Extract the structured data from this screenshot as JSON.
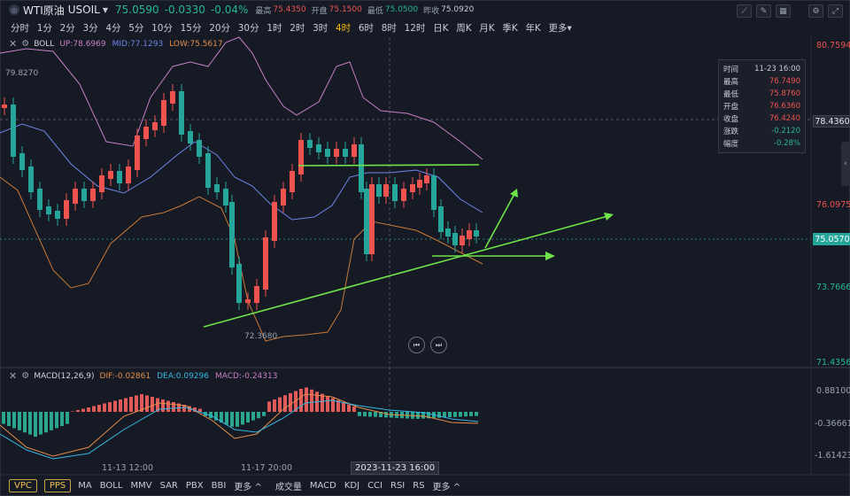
{
  "header": {
    "logo_glyph": "◎",
    "instrument_name": "WTI原油",
    "symbol": "USOIL",
    "price": "75.0590",
    "change": "-0.0330",
    "change_pct": "-0.04%",
    "stats": [
      {
        "label": "最高",
        "value": "75.4350",
        "tone": "red"
      },
      {
        "label": "开盘",
        "value": "75.1500",
        "tone": "red"
      },
      {
        "label": "最低",
        "value": "75.0500",
        "tone": "grn"
      },
      {
        "label": "昨收",
        "value": "75.0920",
        "tone": "gry"
      }
    ],
    "tools": [
      "draw-line-icon",
      "pencil-icon",
      "eraser-icon",
      "settings-icon",
      "fullscreen-icon"
    ]
  },
  "periods": {
    "items": [
      "分时",
      "1分",
      "2分",
      "3分",
      "4分",
      "5分",
      "10分",
      "15分",
      "20分",
      "30分",
      "1时",
      "2时",
      "3时",
      "4时",
      "6时",
      "8时",
      "12时",
      "日K",
      "周K",
      "月K",
      "季K",
      "年K",
      "更多▾"
    ],
    "active": "4时"
  },
  "boll_legend": {
    "name": "BOLL",
    "up": "UP:78.6969",
    "mid": "MID:77.1293",
    "low": "LOW:75.5617"
  },
  "macd_legend": {
    "name": "MACD(12,26,9)",
    "dif": "DIF:-0.02861",
    "dea": "DEA:0.09296",
    "macd": "MACD:-0.24313"
  },
  "price_axis": {
    "labels": [
      {
        "text": "80.7594",
        "tone": "red"
      },
      {
        "text": "76.0975",
        "tone": "red"
      },
      {
        "text": "73.7666",
        "tone": "grn"
      },
      {
        "text": "71.4356",
        "tone": "grn"
      }
    ],
    "crosshair_price": "78.4360",
    "current_price": "75.0570"
  },
  "macd_axis": {
    "labels": [
      "0.88100",
      "-0.36661",
      "-1.61423"
    ]
  },
  "chart_annotations": {
    "high_label": "79.8270",
    "low_label": "72.3680"
  },
  "info_box": {
    "rows": [
      {
        "label": "时间",
        "value": "11-23 16:00",
        "tone": ""
      },
      {
        "label": "最高",
        "value": "76.7490",
        "tone": "red"
      },
      {
        "label": "最低",
        "value": "75.8760",
        "tone": "red"
      },
      {
        "label": "开盘",
        "value": "76.6360",
        "tone": "red"
      },
      {
        "label": "收盘",
        "value": "76.4240",
        "tone": "red"
      },
      {
        "label": "涨跌",
        "value": "-0.2120",
        "tone": "grn"
      },
      {
        "label": "幅度",
        "value": "-0.28%",
        "tone": "grn"
      }
    ]
  },
  "time_axis": {
    "labels": [
      "11-13 12:00",
      "11-17 20:00"
    ],
    "crosshair_time": "2023-11-23 16:00"
  },
  "bottom_bar": {
    "pills": [
      "VPC",
      "PPS"
    ],
    "main_indicators": [
      "MA",
      "BOLL",
      "MMV",
      "SAR",
      "PBX",
      "BBI",
      "更多 ^"
    ],
    "sub_indicators": [
      "成交量",
      "MACD",
      "KDJ",
      "CCI",
      "RSI",
      "RS",
      "更多 ^"
    ]
  },
  "colors": {
    "up": "#ef5350",
    "down": "#26a69a",
    "boll_up": "#c77fc3",
    "boll_mid": "#6d86e8",
    "boll_low": "#c87837",
    "trendline": "#6fe34a",
    "macd_dif": "#e58e48",
    "macd_dea": "#37b8e2"
  },
  "chart_data": [
    {
      "type": "candlestick",
      "title": "USOIL 4时",
      "ylim": [
        71.4356,
        80.7594
      ],
      "indicator": "BOLL",
      "annotations": [
        "79.8270",
        "72.3680"
      ]
    },
    {
      "type": "bar",
      "title": "MACD(12,26,9)",
      "ylim": [
        -1.61423,
        0.881
      ]
    }
  ]
}
